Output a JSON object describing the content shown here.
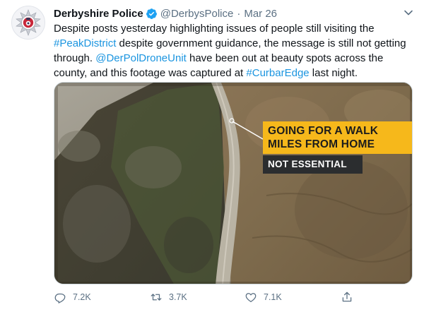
{
  "tweet": {
    "display_name": "Derbyshire Police",
    "handle": "@DerbysPolice",
    "separator": "·",
    "date": "Mar 26",
    "text": {
      "part1": "Despite posts yesterday highlighting issues of people still visiting the ",
      "hashtag1": "#PeakDistrict",
      "part2": " despite government guidance, the message is still not getting through. ",
      "mention1": "@DerPolDroneUnit",
      "part3": " have been out at beauty spots across the county, and this footage was captured at ",
      "hashtag2": "#CurbarEdge",
      "part4": " last night."
    },
    "media": {
      "caption_line1": "GOING FOR A WALK",
      "caption_line2": "MILES FROM HOME",
      "caption_tag": "NOT ESSENTIAL"
    },
    "actions": {
      "replies": "7.2K",
      "retweets": "3.7K",
      "likes": "7.1K"
    },
    "colors": {
      "link": "#1b95e0",
      "verified": "#1da1f2",
      "caption_yellow": "#f6b81b",
      "caption_dark": "#2b2d2f",
      "muted": "#5b7083"
    },
    "icons": {
      "verified": "verified-badge-icon",
      "caret": "chevron-down-icon",
      "reply": "reply-icon",
      "retweet": "retweet-icon",
      "like": "heart-icon",
      "share": "share-icon",
      "avatar": "police-crest-icon"
    }
  }
}
